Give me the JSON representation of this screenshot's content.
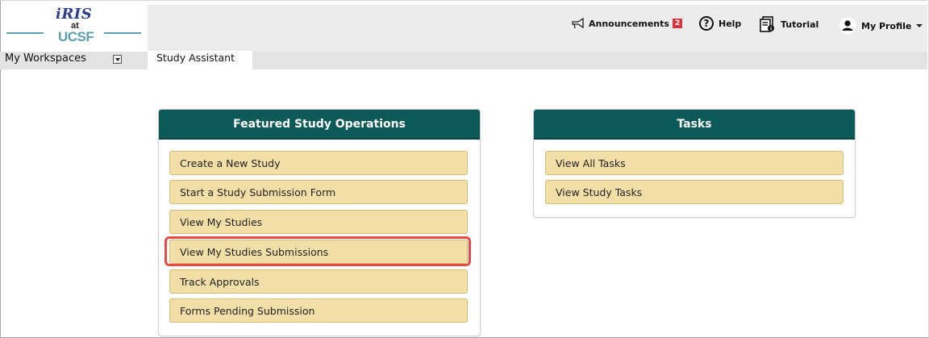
{
  "logo": {
    "iris": "iRIS",
    "at": "at",
    "ucsf": "UCSF"
  },
  "header": {
    "announcements_label": "Announcements",
    "announcements_count": "2",
    "help_label": "Help",
    "tutorial_label": "Tutorial",
    "profile_label": "My Profile"
  },
  "workspace": {
    "label": "My Workspaces",
    "active_tab": "Study Assistant"
  },
  "featured": {
    "title": "Featured Study Operations",
    "items": [
      "Create a New Study",
      "Start a Study Submission Form",
      "View My Studies",
      "View My Studies Submissions",
      "Track Approvals",
      "Forms Pending Submission"
    ]
  },
  "tasks": {
    "title": "Tasks",
    "items": [
      "View All Tasks",
      "View Study Tasks"
    ]
  },
  "colors": {
    "panel_header": "#0b5a57",
    "button_fill": "#f2dfa7",
    "highlight": "#e84a45",
    "badge": "#d9353a"
  }
}
